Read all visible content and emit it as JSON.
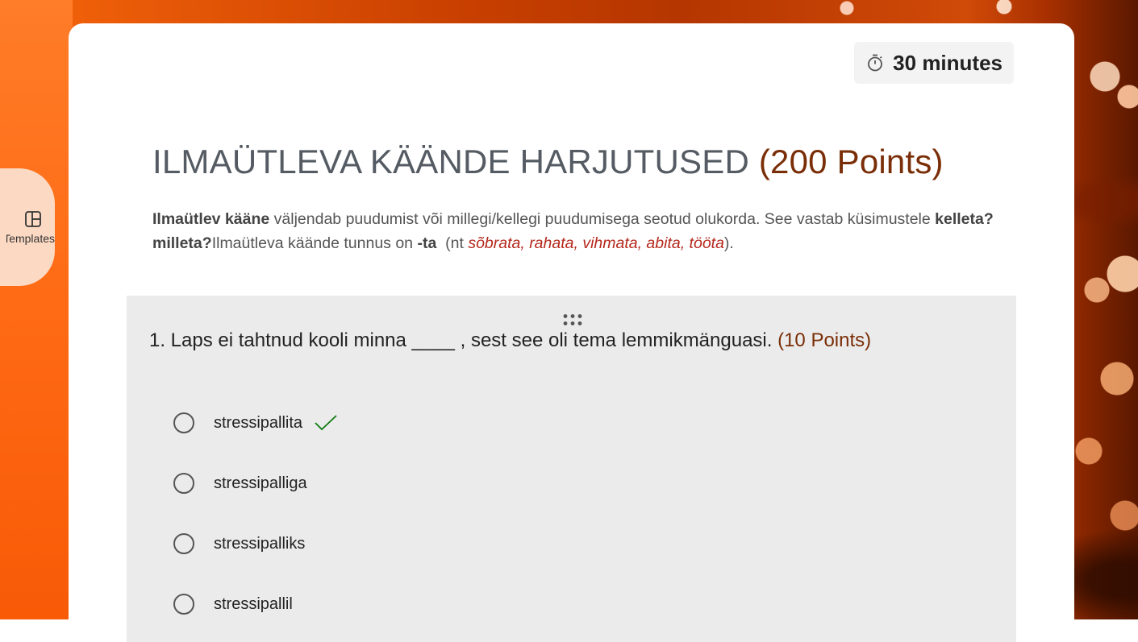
{
  "sidebar": {
    "templates_label": "Templates"
  },
  "timer": {
    "label": "30 minutes"
  },
  "form": {
    "title": "ILMAÜTLEVA KÄÄNDE HARJUTUSED",
    "points": "(200 Points)",
    "description": {
      "term": "Ilmaütlev kääne",
      "part1": " väljendab puudumist või millegi/kellegi puudumisega seotud olukorda. See vastab küsimustele ",
      "questions": "kelleta? milleta?",
      "part2": "Ilmaütleva käände tunnus on ",
      "marker": "-ta",
      "part3": "  (nt ",
      "examples": "sõbrata, rahata, vihmata, abita, tööta",
      "part4": ")."
    }
  },
  "question": {
    "text": "1. Laps ei tahtnud kooli minna ____ , sest see oli tema lemmikmänguasi. ",
    "points": "(10 Points)",
    "options": [
      {
        "label": "stressipallita",
        "correct": true
      },
      {
        "label": "stressipalliga",
        "correct": false
      },
      {
        "label": "stressipalliks",
        "correct": false
      },
      {
        "label": "stressipallil",
        "correct": false
      }
    ]
  },
  "colors": {
    "accent_points": "#7a2e07",
    "example_red": "#b5281c",
    "check_green": "#107c10"
  }
}
